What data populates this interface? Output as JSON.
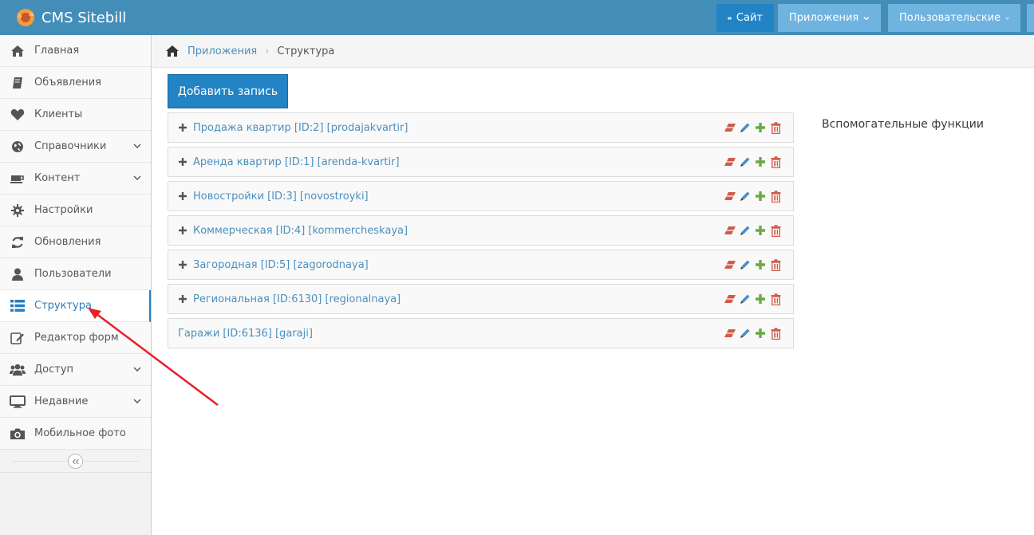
{
  "header": {
    "brand": "CMS Sitebill",
    "site_button": "Сайт",
    "apps_button": "Приложения",
    "user_button": "Пользовательские"
  },
  "sidebar": {
    "items": [
      {
        "label": "Главная",
        "icon": "home-icon"
      },
      {
        "label": "Объявления",
        "icon": "book-icon"
      },
      {
        "label": "Клиенты",
        "icon": "heart-icon"
      },
      {
        "label": "Справочники",
        "icon": "globe-icon",
        "has_submenu": true
      },
      {
        "label": "Контент",
        "icon": "coffee-icon",
        "has_submenu": true
      },
      {
        "label": "Настройки",
        "icon": "gear-icon"
      },
      {
        "label": "Обновления",
        "icon": "refresh-icon"
      },
      {
        "label": "Пользователи",
        "icon": "user-icon"
      },
      {
        "label": "Структура",
        "icon": "list-icon",
        "active": true
      },
      {
        "label": "Редактор форм",
        "icon": "edit-icon"
      },
      {
        "label": "Доступ",
        "icon": "users-icon",
        "has_submenu": true
      },
      {
        "label": "Недавние",
        "icon": "desktop-icon",
        "has_submenu": true
      },
      {
        "label": "Мобильное фото",
        "icon": "camera-icon"
      }
    ]
  },
  "breadcrumb": {
    "items": [
      "Приложения",
      "Структура"
    ]
  },
  "main": {
    "add_button": "Добавить запись",
    "aux_title": "Вспомогательные функции",
    "rows": [
      {
        "label": "Продажа квартир [ID:2] [prodajakvartir]",
        "expandable": true
      },
      {
        "label": "Аренда квартир [ID:1] [arenda-kvartir]",
        "expandable": true
      },
      {
        "label": "Новостройки [ID:3] [novostroyki]",
        "expandable": true
      },
      {
        "label": "Коммерческая [ID:4] [kommercheskaya]",
        "expandable": true
      },
      {
        "label": "Загородная [ID:5] [zagorodnaya]",
        "expandable": true
      },
      {
        "label": "Региональная [ID:6130] [regionalnaya]",
        "expandable": true
      },
      {
        "label": "Гаражи [ID:6136] [garaji]",
        "expandable": false
      }
    ]
  },
  "colors": {
    "topbar": "#438eb9",
    "link": "#4c8fbd",
    "eraser": "#d15b47",
    "pencil": "#478fca",
    "plus": "#69aa46",
    "trash": "#d15b47",
    "annotation_arrow": "#e8202a"
  }
}
